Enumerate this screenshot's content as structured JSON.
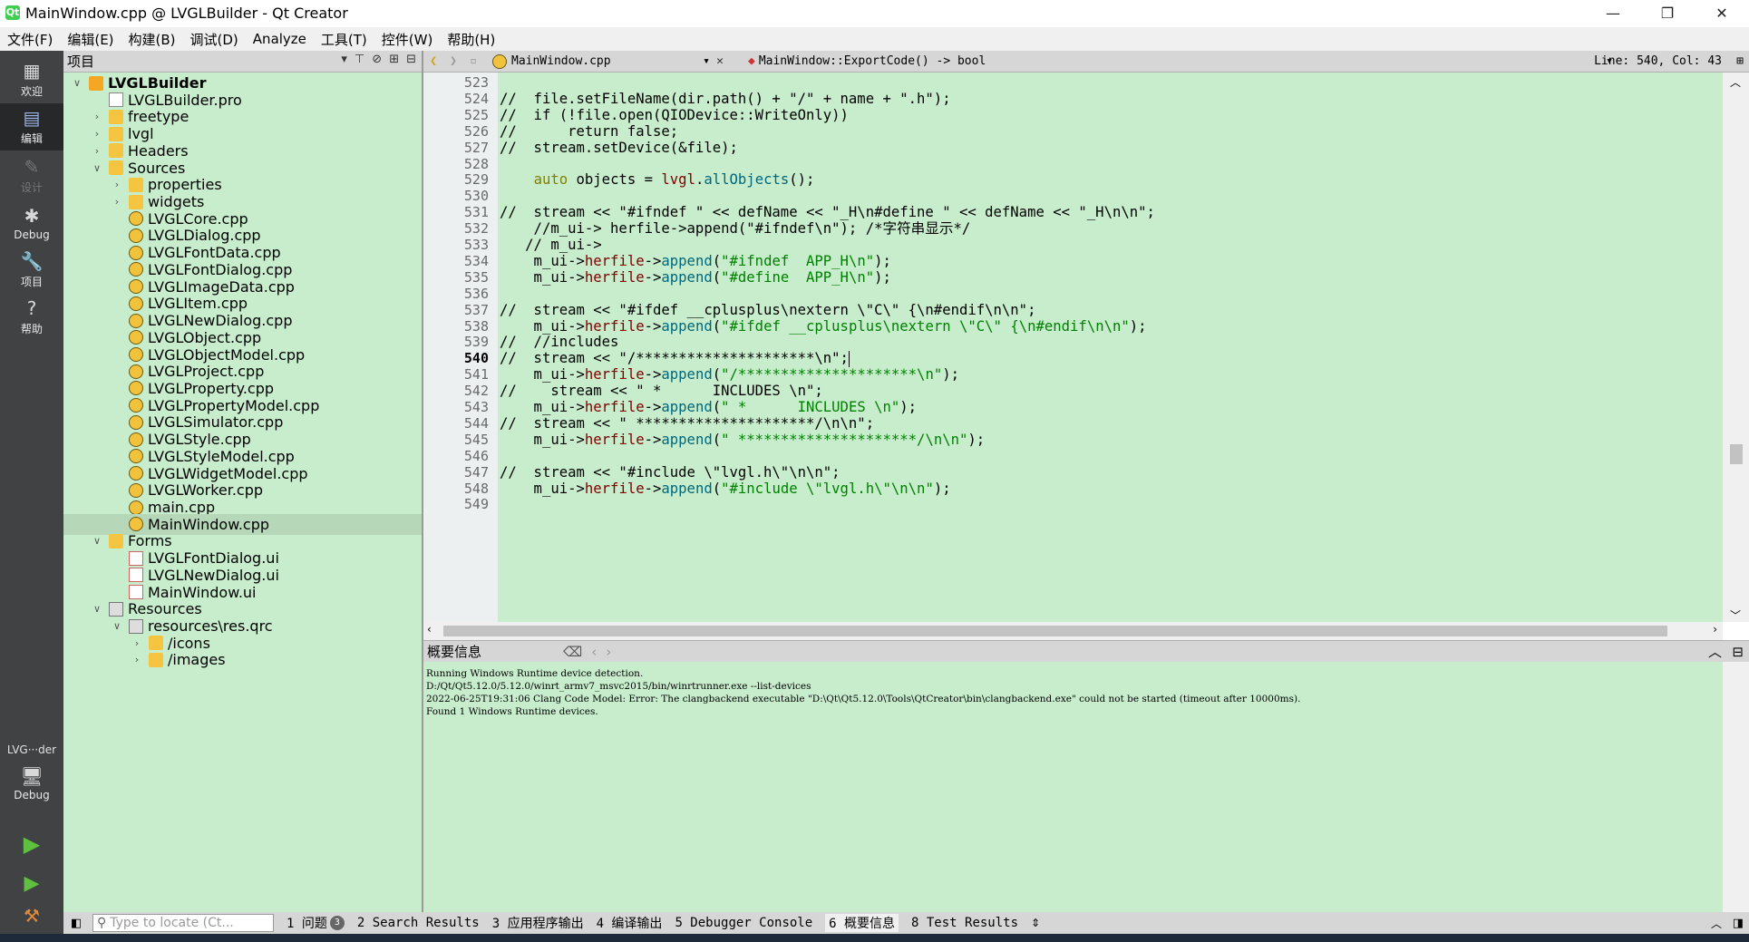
{
  "window": {
    "title": "MainWindow.cpp @ LVGLBuilder - Qt Creator",
    "icon_label": "Qt",
    "controls": [
      "—",
      "❐",
      "✕"
    ]
  },
  "menu": [
    "文件(F)",
    "编辑(E)",
    "构建(B)",
    "调试(D)",
    "Analyze",
    "工具(T)",
    "控件(W)",
    "帮助(H)"
  ],
  "modes": [
    {
      "label": "欢迎",
      "icon": "grid-icon"
    },
    {
      "label": "编辑",
      "icon": "edit-icon"
    },
    {
      "label": "设计",
      "icon": "pencil-icon"
    },
    {
      "label": "Debug",
      "icon": "bug-icon"
    },
    {
      "label": "项目",
      "icon": "wrench-icon"
    },
    {
      "label": "帮助",
      "icon": "help-icon"
    }
  ],
  "target": {
    "name": "LVG···der",
    "config": "Debug"
  },
  "project_panel": {
    "title": "项目"
  },
  "tree": [
    {
      "label": "LVGLBuilder",
      "depth": 0,
      "arrow": "down",
      "icon": "proj",
      "bold": true
    },
    {
      "label": "LVGLBuilder.pro",
      "depth": 1,
      "arrow": "",
      "icon": "file"
    },
    {
      "label": "freetype",
      "depth": 1,
      "arrow": "right",
      "icon": "folder"
    },
    {
      "label": "lvgl",
      "depth": 1,
      "arrow": "right",
      "icon": "folder"
    },
    {
      "label": "Headers",
      "depth": 1,
      "arrow": "right",
      "icon": "folder"
    },
    {
      "label": "Sources",
      "depth": 1,
      "arrow": "down",
      "icon": "folder"
    },
    {
      "label": "properties",
      "depth": 2,
      "arrow": "right",
      "icon": "folder"
    },
    {
      "label": "widgets",
      "depth": 2,
      "arrow": "right",
      "icon": "folder"
    },
    {
      "label": "LVGLCore.cpp",
      "depth": 2,
      "arrow": "",
      "icon": "cpp"
    },
    {
      "label": "LVGLDialog.cpp",
      "depth": 2,
      "arrow": "",
      "icon": "cpp"
    },
    {
      "label": "LVGLFontData.cpp",
      "depth": 2,
      "arrow": "",
      "icon": "cpp"
    },
    {
      "label": "LVGLFontDialog.cpp",
      "depth": 2,
      "arrow": "",
      "icon": "cpp"
    },
    {
      "label": "LVGLImageData.cpp",
      "depth": 2,
      "arrow": "",
      "icon": "cpp"
    },
    {
      "label": "LVGLItem.cpp",
      "depth": 2,
      "arrow": "",
      "icon": "cpp"
    },
    {
      "label": "LVGLNewDialog.cpp",
      "depth": 2,
      "arrow": "",
      "icon": "cpp"
    },
    {
      "label": "LVGLObject.cpp",
      "depth": 2,
      "arrow": "",
      "icon": "cpp"
    },
    {
      "label": "LVGLObjectModel.cpp",
      "depth": 2,
      "arrow": "",
      "icon": "cpp"
    },
    {
      "label": "LVGLProject.cpp",
      "depth": 2,
      "arrow": "",
      "icon": "cpp"
    },
    {
      "label": "LVGLProperty.cpp",
      "depth": 2,
      "arrow": "",
      "icon": "cpp"
    },
    {
      "label": "LVGLPropertyModel.cpp",
      "depth": 2,
      "arrow": "",
      "icon": "cpp"
    },
    {
      "label": "LVGLSimulator.cpp",
      "depth": 2,
      "arrow": "",
      "icon": "cpp"
    },
    {
      "label": "LVGLStyle.cpp",
      "depth": 2,
      "arrow": "",
      "icon": "cpp"
    },
    {
      "label": "LVGLStyleModel.cpp",
      "depth": 2,
      "arrow": "",
      "icon": "cpp"
    },
    {
      "label": "LVGLWidgetModel.cpp",
      "depth": 2,
      "arrow": "",
      "icon": "cpp"
    },
    {
      "label": "LVGLWorker.cpp",
      "depth": 2,
      "arrow": "",
      "icon": "cpp"
    },
    {
      "label": "main.cpp",
      "depth": 2,
      "arrow": "",
      "icon": "cpp"
    },
    {
      "label": "MainWindow.cpp",
      "depth": 2,
      "arrow": "",
      "icon": "cpp",
      "selected": true
    },
    {
      "label": "Forms",
      "depth": 1,
      "arrow": "down",
      "icon": "folder"
    },
    {
      "label": "LVGLFontDialog.ui",
      "depth": 2,
      "arrow": "",
      "icon": "ui"
    },
    {
      "label": "LVGLNewDialog.ui",
      "depth": 2,
      "arrow": "",
      "icon": "ui"
    },
    {
      "label": "MainWindow.ui",
      "depth": 2,
      "arrow": "",
      "icon": "ui"
    },
    {
      "label": "Resources",
      "depth": 1,
      "arrow": "down",
      "icon": "lock"
    },
    {
      "label": "resources\\res.qrc",
      "depth": 2,
      "arrow": "down",
      "icon": "lock"
    },
    {
      "label": "/icons",
      "depth": 3,
      "arrow": "right",
      "icon": "folder"
    },
    {
      "label": "/images",
      "depth": 3,
      "arrow": "right",
      "icon": "folder"
    }
  ],
  "editor": {
    "filename": "MainWindow.cpp",
    "symbol": "MainWindow::ExportCode() -> bool",
    "position": "Line: 540, Col: 43",
    "current_line": 540,
    "lines": [
      {
        "n": 523,
        "t": ""
      },
      {
        "n": 524,
        "t": "//  file.setFileName(dir.path() + \"/\" + name + \".h\");"
      },
      {
        "n": 525,
        "t": "//  if (!file.open(QIODevice::WriteOnly))"
      },
      {
        "n": 526,
        "t": "//      return false;"
      },
      {
        "n": 527,
        "t": "//  stream.setDevice(&file);"
      },
      {
        "n": 528,
        "t": ""
      },
      {
        "n": 529,
        "t": "    auto objects = lvgl.allObjects();"
      },
      {
        "n": 530,
        "t": ""
      },
      {
        "n": 531,
        "t": "//  stream << \"#ifndef \" << defName << \"_H\\n#define \" << defName << \"_H\\n\\n\";"
      },
      {
        "n": 532,
        "t": "    //m_ui-> herfile->append(\"#ifndef\\n\"); /*字符串显示*/"
      },
      {
        "n": 533,
        "t": "   // m_ui->"
      },
      {
        "n": 534,
        "t": "    m_ui->herfile->append(\"#ifndef  APP_H\\n\");"
      },
      {
        "n": 535,
        "t": "    m_ui->herfile->append(\"#define  APP_H\\n\");"
      },
      {
        "n": 536,
        "t": ""
      },
      {
        "n": 537,
        "t": "//  stream << \"#ifdef __cplusplus\\nextern \\\"C\\\" {\\n#endif\\n\\n\";"
      },
      {
        "n": 538,
        "t": "    m_ui->herfile->append(\"#ifdef __cplusplus\\nextern \\\"C\\\" {\\n#endif\\n\\n\");"
      },
      {
        "n": 539,
        "t": "//  //includes"
      },
      {
        "n": 540,
        "t": "//  stream << \"/*********************\\n\";"
      },
      {
        "n": 541,
        "t": "    m_ui->herfile->append(\"/*********************\\n\");"
      },
      {
        "n": 542,
        "t": "//    stream << \" *      INCLUDES \\n\";"
      },
      {
        "n": 543,
        "t": "    m_ui->herfile->append(\" *      INCLUDES \\n\");"
      },
      {
        "n": 544,
        "t": "//  stream << \" *********************/\\n\\n\";"
      },
      {
        "n": 545,
        "t": "    m_ui->herfile->append(\" *********************/\\n\\n\");"
      },
      {
        "n": 546,
        "t": ""
      },
      {
        "n": 547,
        "t": "//  stream << \"#include \\\"lvgl.h\\\"\\n\\n\";"
      },
      {
        "n": 548,
        "t": "    m_ui->herfile->append(\"#include \\\"lvgl.h\\\"\\n\\n\");"
      },
      {
        "n": 549,
        "t": ""
      }
    ]
  },
  "output": {
    "title": "概要信息",
    "lines": [
      "Running Windows Runtime device detection.",
      "D:/Qt/Qt5.12.0/5.12.0/winrt_armv7_msvc2015/bin/winrtrunner.exe --list-devices",
      "2022-06-25T19:31:06 Clang Code Model: Error: The clangbackend executable \"D:\\Qt\\Qt5.12.0\\Tools\\QtCreator\\bin\\clangbackend.exe\" could not be started (timeout after 10000ms).",
      "Found 1 Windows Runtime devices."
    ]
  },
  "statusbar": {
    "locate_placeholder": "Type to locate (Ct...",
    "tabs": [
      {
        "label": "1 问题",
        "badge": "3"
      },
      {
        "label": "2 Search Results"
      },
      {
        "label": "3 应用程序输出"
      },
      {
        "label": "4 编译输出"
      },
      {
        "label": "5 Debugger Console"
      },
      {
        "label": "6 概要信息",
        "active": true
      },
      {
        "label": "8 Test Results"
      }
    ]
  },
  "colors": {
    "background_green": "#c7edcc",
    "mode_bar": "#404244",
    "keyword": "#808000",
    "function": "#00677c",
    "member": "#800000",
    "string": "#008000"
  }
}
